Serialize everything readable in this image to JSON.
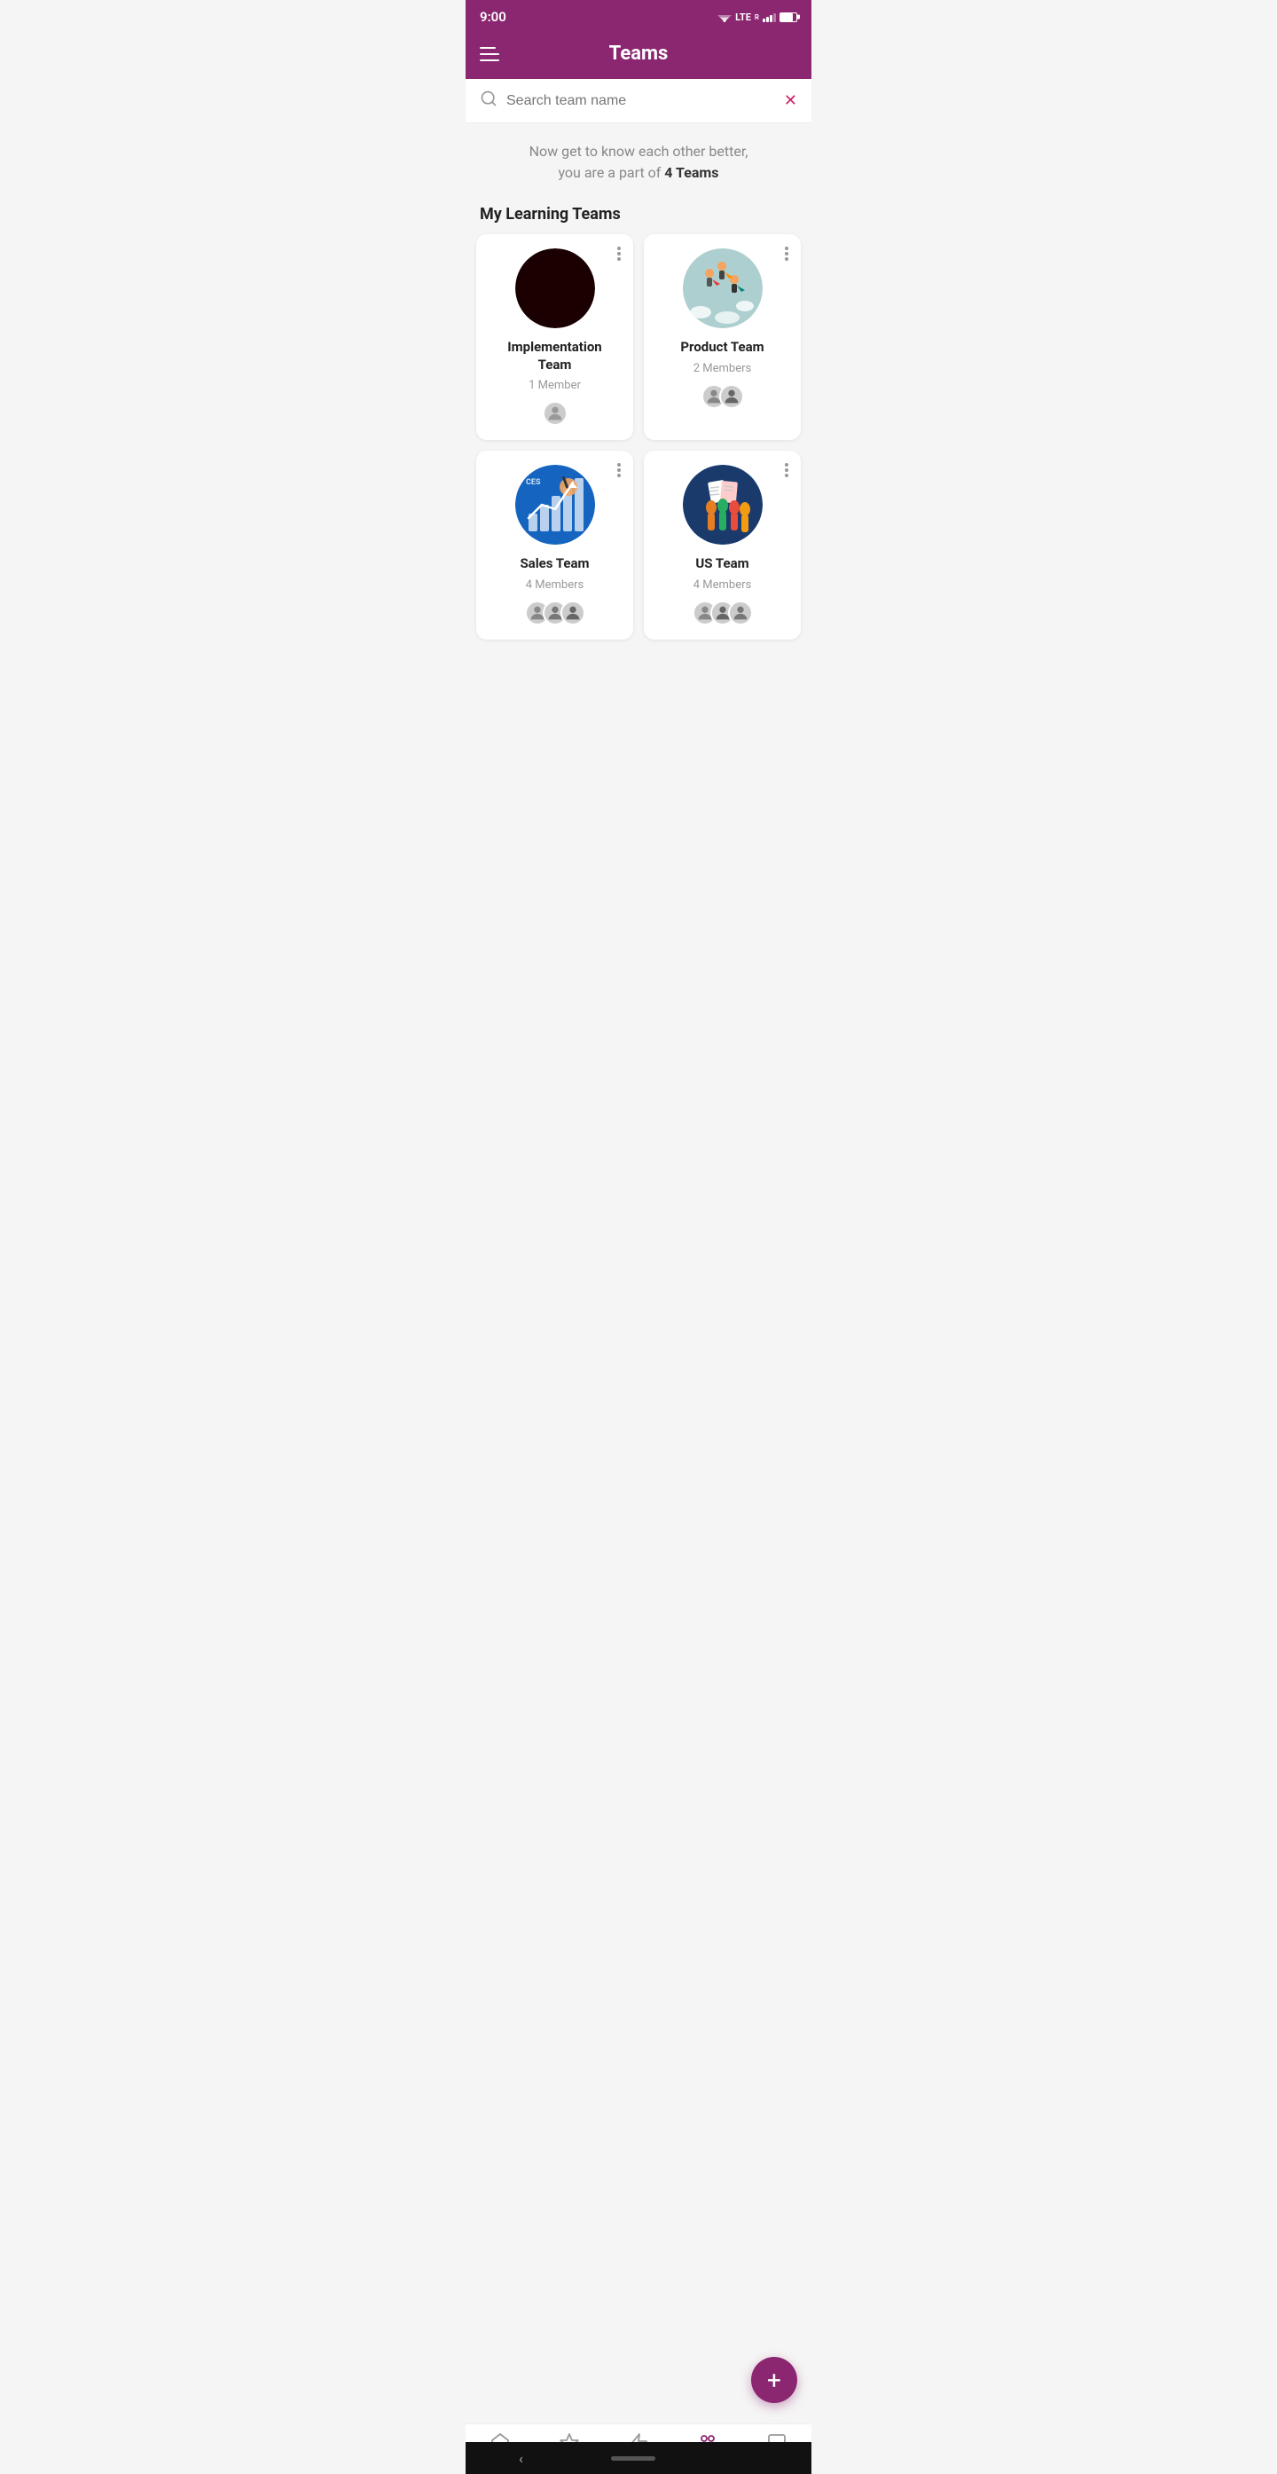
{
  "statusBar": {
    "time": "9:00",
    "lte": "LTE",
    "superscript": "R"
  },
  "header": {
    "title": "Teams",
    "menuLabel": "menu"
  },
  "search": {
    "placeholder": "Search team name"
  },
  "intro": {
    "text": "Now get to know each other better,",
    "text2": "you are a part of ",
    "highlight": "4 Teams"
  },
  "sectionTitle": "My Learning Teams",
  "teams": [
    {
      "id": "implementation",
      "name": "Implementation Team",
      "memberCount": "1 Member",
      "avatarType": "dark"
    },
    {
      "id": "product",
      "name": "Product Team",
      "memberCount": "2 Members",
      "avatarType": "light-blue"
    },
    {
      "id": "sales",
      "name": "Sales Team",
      "memberCount": "4 Members",
      "avatarType": "blue-chart"
    },
    {
      "id": "us",
      "name": "US Team",
      "memberCount": "4 Members",
      "avatarType": "blue-hands"
    }
  ],
  "fab": {
    "label": "+"
  },
  "bottomNav": {
    "items": [
      {
        "id": "home",
        "label": "Home",
        "active": false
      },
      {
        "id": "leaderboard",
        "label": "Leaderboard",
        "active": false
      },
      {
        "id": "buzz",
        "label": "Buzz",
        "active": false
      },
      {
        "id": "teams",
        "label": "Teams",
        "active": true
      },
      {
        "id": "chats",
        "label": "Chats",
        "active": false
      }
    ]
  }
}
